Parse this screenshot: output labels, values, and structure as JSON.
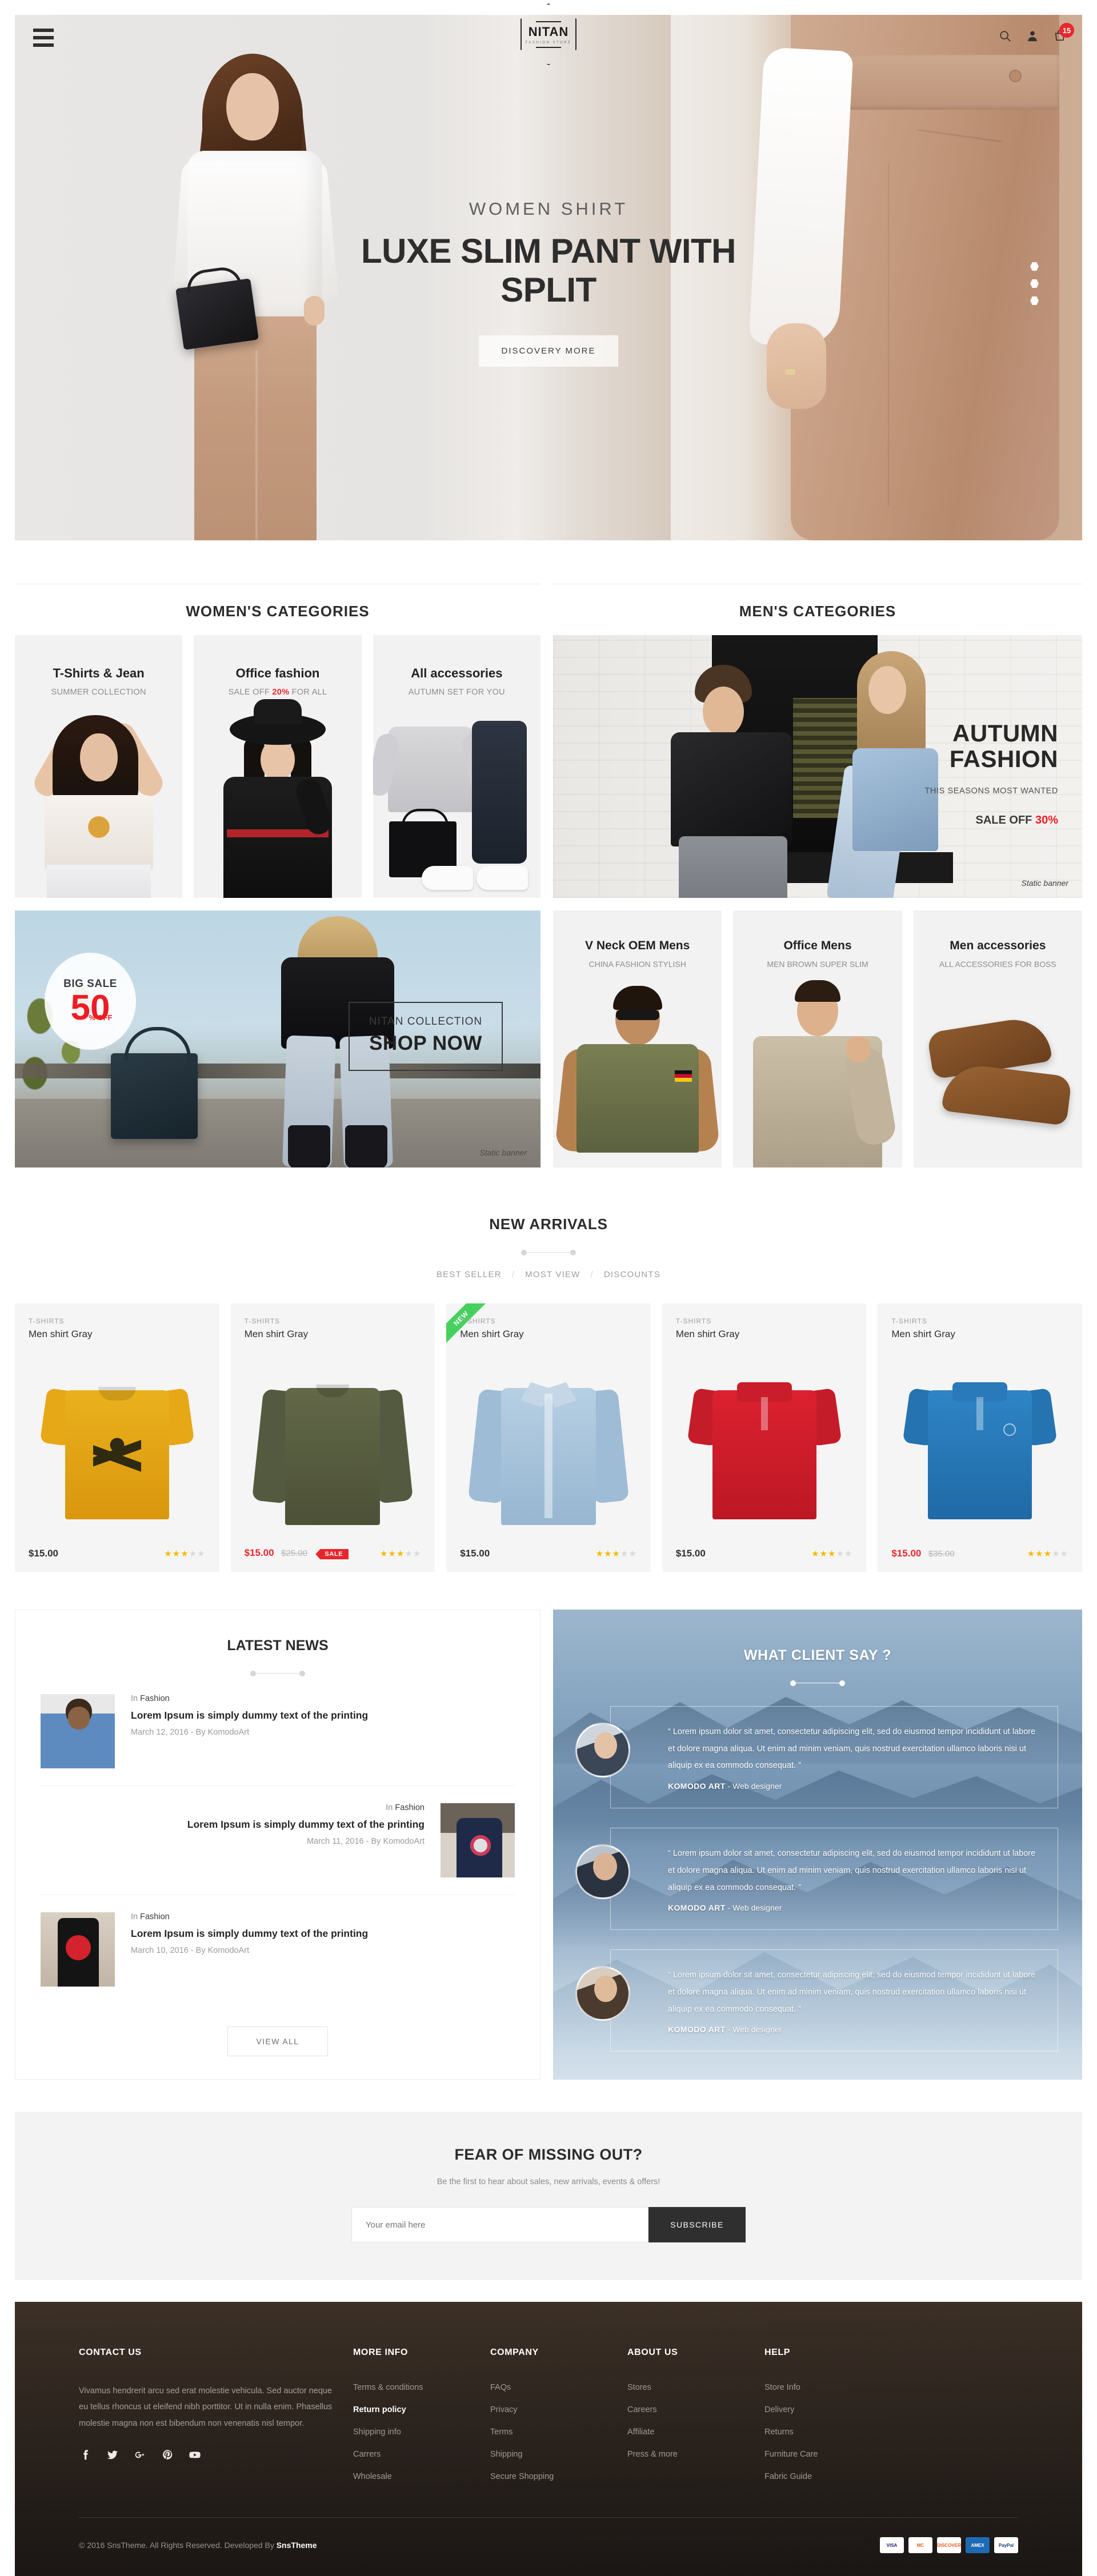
{
  "header": {
    "menu_icon": "hamburger-icon",
    "logo_name": "NITAN",
    "logo_tagline": "FASHION STORE",
    "search_icon": "search-icon",
    "user_icon": "user-icon",
    "cart_icon": "cart-icon",
    "cart_count": "15"
  },
  "hero": {
    "subtitle": "WOMEN SHIRT",
    "title": "LUXE SLIM PANT WITH SPLIT",
    "button": "DISCOVERY MORE",
    "slides": [
      "1",
      "2",
      "3"
    ],
    "active_slide": 2
  },
  "women": {
    "title": "WOMEN'S CATEGORIES",
    "cards": [
      {
        "title": "T-Shirts & Jean",
        "sub_pre": "SUMMER COLLECTION",
        "sub_hl": "",
        "sub_post": ""
      },
      {
        "title": "Office fashion",
        "sub_pre": "SALE OFF ",
        "sub_hl": "20%",
        "sub_post": " FOR ALL"
      },
      {
        "title": "All accessories",
        "sub_pre": "AUTUMN SET FOR YOU",
        "sub_hl": "",
        "sub_post": ""
      }
    ],
    "banner": {
      "badge_label": "BIG SALE",
      "badge_number": "50",
      "badge_suffix": "% OFF",
      "collection": "NITAN COLLECTION",
      "cta": "SHOP NOW",
      "note": "Static banner"
    }
  },
  "men": {
    "title": "MEN'S CATEGORIES",
    "banner": {
      "line1": "AUTUMN",
      "line2": "FASHION",
      "tagline": "THIS SEASONS MOST WANTED",
      "sale_pre": "SALE OFF ",
      "sale_hl": "30%",
      "note": "Static banner"
    },
    "cards": [
      {
        "title": "V Neck OEM Mens",
        "sub": "CHINA FASHION STYLISH"
      },
      {
        "title": "Office Mens",
        "sub": "MEN BROWN SUPER SLIM"
      },
      {
        "title": "Men accessories",
        "sub": "ALL ACCESSORIES FOR BOSS"
      }
    ]
  },
  "arrivals": {
    "title": "NEW ARRIVALS",
    "tabs": [
      "BEST SELLER",
      "MOST VIEW",
      "DISCOUNTS"
    ],
    "separator": "/",
    "products": [
      {
        "category": "T-SHIRTS",
        "name": "Men shirt Gray",
        "price": "$15.00",
        "old_price": "",
        "badge": "",
        "rating": 3,
        "color": "#e6a817"
      },
      {
        "category": "T-SHIRTS",
        "name": "Men shirt Gray",
        "price": "$15.00",
        "old_price": "$25.00",
        "badge": "SALE",
        "rating": 3,
        "color": "#5a6045"
      },
      {
        "category": "T-SHIRTS",
        "name": "Men shirt Gray",
        "price": "$15.00",
        "old_price": "",
        "badge": "NEW",
        "rating": 3,
        "color": "#a9c3da"
      },
      {
        "category": "T-SHIRTS",
        "name": "Men shirt Gray",
        "price": "$15.00",
        "old_price": "",
        "badge": "",
        "rating": 3,
        "color": "#d8202f"
      },
      {
        "category": "T-SHIRTS",
        "name": "Men shirt Gray",
        "price": "$15.00",
        "old_price": "$35.00",
        "badge": "",
        "rating": 3,
        "color": "#2a7fc1"
      }
    ]
  },
  "news": {
    "title": "LATEST NEWS",
    "items": [
      {
        "category_pre": "In ",
        "category": "Fashion",
        "headline": "Lorem Ipsum is simply dummy text of the printing",
        "meta": "March 12, 2016 - By KomodoArt"
      },
      {
        "category_pre": "In ",
        "category": "Fashion",
        "headline": "Lorem Ipsum is simply dummy text of the printing",
        "meta": "March 11, 2016 - By KomodoArt"
      },
      {
        "category_pre": "In ",
        "category": "Fashion",
        "headline": "Lorem Ipsum is simply dummy text of the printing",
        "meta": "March 10, 2016 - By KomodoArt"
      }
    ],
    "view_all": "VIEW ALL"
  },
  "testimonials": {
    "title": "WHAT CLIENT SAY ?",
    "items": [
      {
        "quote": "“ Lorem ipsum dolor sit amet, consectetur adipiscing elit, sed do eiusmod tempor incididunt ut labore et dolore magna aliqua. Ut enim ad minim veniam, quis nostrud exercitation ullamco laboris nisi ut aliquip ex ea commodo consequat. ”",
        "author": "KOMODO ART",
        "role": " - Web designer"
      },
      {
        "quote": "“ Lorem ipsum dolor sit amet, consectetur adipiscing elit, sed do eiusmod tempor incididunt ut labore et dolore magna aliqua. Ut enim ad minim veniam, quis nostrud exercitation ullamco laboris nisi ut aliquip ex ea commodo consequat. ”",
        "author": "KOMODO ART",
        "role": " - Web designer"
      },
      {
        "quote": "“ Lorem ipsum dolor sit amet, consectetur adipiscing elit, sed do eiusmod tempor incididunt ut labore et dolore magna aliqua. Ut enim ad minim veniam, quis nostrud exercitation ullamco laboris nisi ut aliquip ex ea commodo consequat. ”",
        "author": "KOMODO ART",
        "role": " - Web designer"
      }
    ]
  },
  "newsletter": {
    "title": "FEAR OF MISSING OUT?",
    "subtitle": "Be the first to hear about sales, new arrivals, events & offers!",
    "placeholder": "Your email here",
    "button": "SUBSCRIBE"
  },
  "footer": {
    "contact": {
      "heading": "CONTACT US",
      "text": "Vivamus hendrerit arcu sed erat molestie vehicula. Sed auctor neque eu tellus rhoncus ut eleifend nibh porttitor. Ut in nulla enim. Phasellus molestie magna non est bibendum non venenatis nisl tempor.",
      "social": [
        "facebook-icon",
        "twitter-icon",
        "google-plus-icon",
        "pinterest-icon",
        "youtube-icon"
      ]
    },
    "columns": [
      {
        "heading": "MORE INFO",
        "links": [
          "Terms & conditions",
          "Return policy",
          "Shipping info",
          "Carrers",
          "Wholesale"
        ],
        "active": 1
      },
      {
        "heading": "COMPANY",
        "links": [
          "FAQs",
          "Privacy",
          "Terms",
          "Shipping",
          "Secure Shopping"
        ],
        "active": -1
      },
      {
        "heading": "ABOUT US",
        "links": [
          "Stores",
          "Careers",
          "Affiliate",
          "Press & more"
        ],
        "active": -1
      },
      {
        "heading": "HELP",
        "links": [
          "Store Info",
          "Delivery",
          "Returns",
          "Furniture Care",
          "Fabric Guide"
        ],
        "active": -1
      }
    ],
    "copyright_pre": "© 2016 SnsTheme. All Rights Reserved. Developed By ",
    "copyright_brand": "SnsTheme",
    "payments": [
      "VISA",
      "MC",
      "DISCOVER",
      "AMEX",
      "PayPal"
    ]
  },
  "colors": {
    "accent_red": "#e8262c",
    "star_gold": "#f3b900",
    "new_green": "#46d15e",
    "dark": "#2f2f2f"
  }
}
